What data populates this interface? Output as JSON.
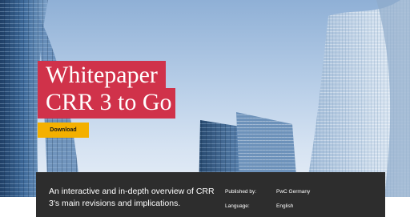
{
  "hero": {
    "title_line1": "Whitepaper",
    "title_line2": "CRR 3 to Go",
    "download_label": "Download",
    "colors": {
      "title_background": "#d0324a",
      "download_background": "#f4b000",
      "sky": "#b9cfe8"
    }
  },
  "info": {
    "description": "An interactive and in-depth overview of CRR 3's main revisions and implications.",
    "published_by_label": "Published by:",
    "published_by_value": "PwC Germany",
    "language_label": "Language:",
    "language_value": "English",
    "background_color": "#2d2d2d"
  }
}
